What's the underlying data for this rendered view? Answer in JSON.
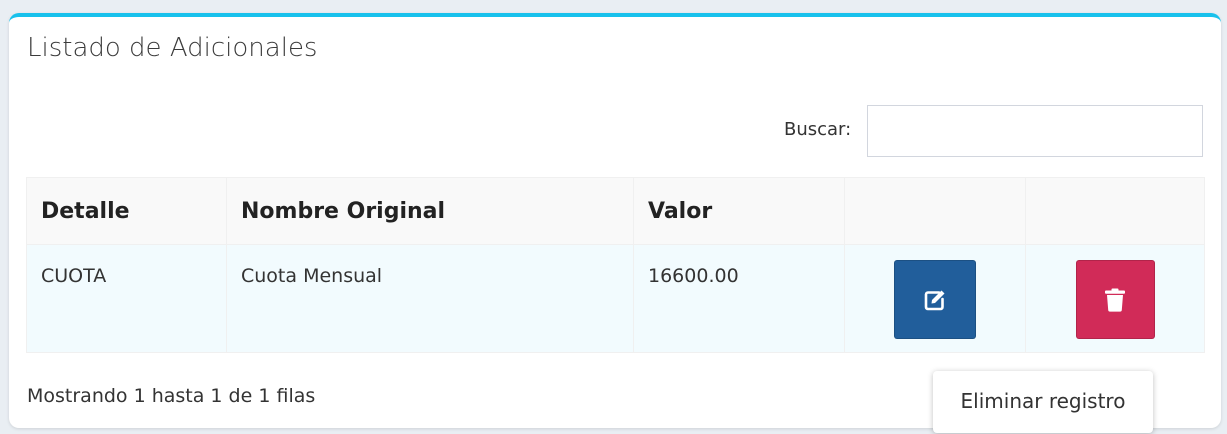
{
  "card": {
    "title": "Listado de Adicionales"
  },
  "search": {
    "label": "Buscar:",
    "value": "",
    "placeholder": ""
  },
  "table": {
    "columns": [
      "Detalle",
      "Nombre Original",
      "Valor",
      "",
      ""
    ],
    "rows": [
      {
        "detalle": "CUOTA",
        "nombre_original": "Cuota Mensual",
        "valor": "16600.00",
        "edit_icon": "edit-icon",
        "delete_icon": "trash-icon"
      }
    ]
  },
  "footer": {
    "info": "Mostrando 1 hasta 1 de 1 filas"
  },
  "tooltip": {
    "text": "Eliminar registro"
  },
  "colors": {
    "accent": "#18c1ec",
    "edit_button": "#215e9b",
    "delete_button": "#d12b58",
    "row_background": "#f2fbfe"
  }
}
